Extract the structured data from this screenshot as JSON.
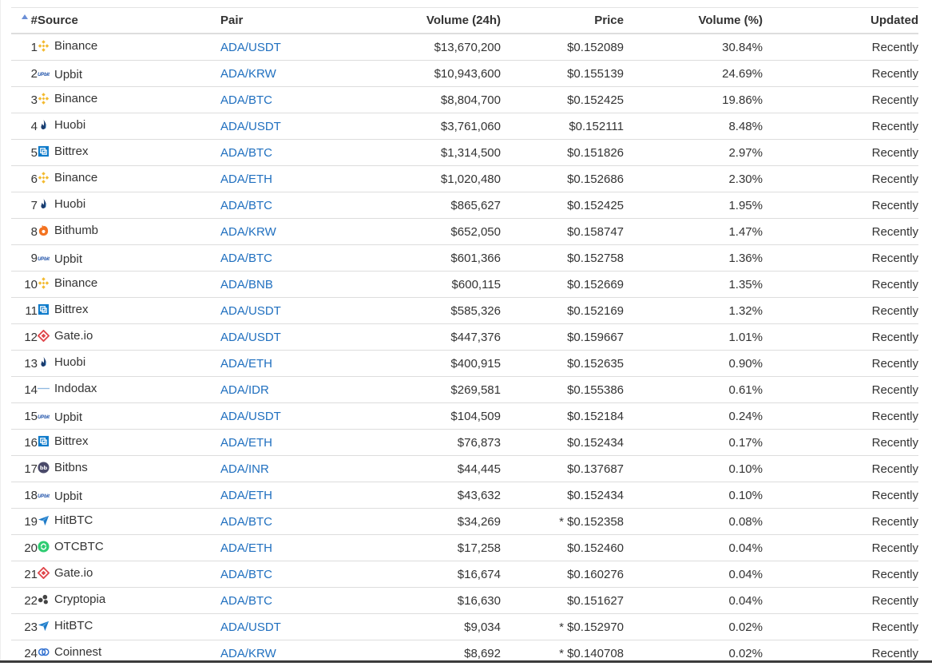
{
  "table": {
    "columns": {
      "rank": "#",
      "source": "Source",
      "pair": "Pair",
      "volume": "Volume (24h)",
      "price": "Price",
      "volume_pct": "Volume (%)",
      "updated": "Updated"
    },
    "sort_indicator": "sort-ascending-icon",
    "rows": [
      {
        "rank": "1",
        "source": "Binance",
        "icon": "binance-icon",
        "pair": "ADA/USDT",
        "volume": "$13,670,200",
        "price": "$0.152089",
        "estimated": "",
        "pct": "30.84%",
        "updated": "Recently"
      },
      {
        "rank": "2",
        "source": "Upbit",
        "icon": "upbit-icon",
        "pair": "ADA/KRW",
        "volume": "$10,943,600",
        "price": "$0.155139",
        "estimated": "",
        "pct": "24.69%",
        "updated": "Recently"
      },
      {
        "rank": "3",
        "source": "Binance",
        "icon": "binance-icon",
        "pair": "ADA/BTC",
        "volume": "$8,804,700",
        "price": "$0.152425",
        "estimated": "",
        "pct": "19.86%",
        "updated": "Recently"
      },
      {
        "rank": "4",
        "source": "Huobi",
        "icon": "huobi-icon",
        "pair": "ADA/USDT",
        "volume": "$3,761,060",
        "price": "$0.152111",
        "estimated": "",
        "pct": "8.48%",
        "updated": "Recently"
      },
      {
        "rank": "5",
        "source": "Bittrex",
        "icon": "bittrex-icon",
        "pair": "ADA/BTC",
        "volume": "$1,314,500",
        "price": "$0.151826",
        "estimated": "",
        "pct": "2.97%",
        "updated": "Recently"
      },
      {
        "rank": "6",
        "source": "Binance",
        "icon": "binance-icon",
        "pair": "ADA/ETH",
        "volume": "$1,020,480",
        "price": "$0.152686",
        "estimated": "",
        "pct": "2.30%",
        "updated": "Recently"
      },
      {
        "rank": "7",
        "source": "Huobi",
        "icon": "huobi-icon",
        "pair": "ADA/BTC",
        "volume": "$865,627",
        "price": "$0.152425",
        "estimated": "",
        "pct": "1.95%",
        "updated": "Recently"
      },
      {
        "rank": "8",
        "source": "Bithumb",
        "icon": "bithumb-icon",
        "pair": "ADA/KRW",
        "volume": "$652,050",
        "price": "$0.158747",
        "estimated": "",
        "pct": "1.47%",
        "updated": "Recently"
      },
      {
        "rank": "9",
        "source": "Upbit",
        "icon": "upbit-icon",
        "pair": "ADA/BTC",
        "volume": "$601,366",
        "price": "$0.152758",
        "estimated": "",
        "pct": "1.36%",
        "updated": "Recently"
      },
      {
        "rank": "10",
        "source": "Binance",
        "icon": "binance-icon",
        "pair": "ADA/BNB",
        "volume": "$600,115",
        "price": "$0.152669",
        "estimated": "",
        "pct": "1.35%",
        "updated": "Recently"
      },
      {
        "rank": "11",
        "source": "Bittrex",
        "icon": "bittrex-icon",
        "pair": "ADA/USDT",
        "volume": "$585,326",
        "price": "$0.152169",
        "estimated": "",
        "pct": "1.32%",
        "updated": "Recently"
      },
      {
        "rank": "12",
        "source": "Gate.io",
        "icon": "gateio-icon",
        "pair": "ADA/USDT",
        "volume": "$447,376",
        "price": "$0.159667",
        "estimated": "",
        "pct": "1.01%",
        "updated": "Recently"
      },
      {
        "rank": "13",
        "source": "Huobi",
        "icon": "huobi-icon",
        "pair": "ADA/ETH",
        "volume": "$400,915",
        "price": "$0.152635",
        "estimated": "",
        "pct": "0.90%",
        "updated": "Recently"
      },
      {
        "rank": "14",
        "source": "Indodax",
        "icon": "indodax-icon",
        "pair": "ADA/IDR",
        "volume": "$269,581",
        "price": "$0.155386",
        "estimated": "",
        "pct": "0.61%",
        "updated": "Recently"
      },
      {
        "rank": "15",
        "source": "Upbit",
        "icon": "upbit-icon",
        "pair": "ADA/USDT",
        "volume": "$104,509",
        "price": "$0.152184",
        "estimated": "",
        "pct": "0.24%",
        "updated": "Recently"
      },
      {
        "rank": "16",
        "source": "Bittrex",
        "icon": "bittrex-icon",
        "pair": "ADA/ETH",
        "volume": "$76,873",
        "price": "$0.152434",
        "estimated": "",
        "pct": "0.17%",
        "updated": "Recently"
      },
      {
        "rank": "17",
        "source": "Bitbns",
        "icon": "bitbns-icon",
        "pair": "ADA/INR",
        "volume": "$44,445",
        "price": "$0.137687",
        "estimated": "",
        "pct": "0.10%",
        "updated": "Recently"
      },
      {
        "rank": "18",
        "source": "Upbit",
        "icon": "upbit-icon",
        "pair": "ADA/ETH",
        "volume": "$43,632",
        "price": "$0.152434",
        "estimated": "",
        "pct": "0.10%",
        "updated": "Recently"
      },
      {
        "rank": "19",
        "source": "HitBTC",
        "icon": "hitbtc-icon",
        "pair": "ADA/BTC",
        "volume": "$34,269",
        "price": "$0.152358",
        "estimated": "*",
        "pct": "0.08%",
        "updated": "Recently"
      },
      {
        "rank": "20",
        "source": "OTCBTC",
        "icon": "otcbtc-icon",
        "pair": "ADA/ETH",
        "volume": "$17,258",
        "price": "$0.152460",
        "estimated": "",
        "pct": "0.04%",
        "updated": "Recently"
      },
      {
        "rank": "21",
        "source": "Gate.io",
        "icon": "gateio-icon",
        "pair": "ADA/BTC",
        "volume": "$16,674",
        "price": "$0.160276",
        "estimated": "",
        "pct": "0.04%",
        "updated": "Recently"
      },
      {
        "rank": "22",
        "source": "Cryptopia",
        "icon": "cryptopia-icon",
        "pair": "ADA/BTC",
        "volume": "$16,630",
        "price": "$0.151627",
        "estimated": "",
        "pct": "0.04%",
        "updated": "Recently"
      },
      {
        "rank": "23",
        "source": "HitBTC",
        "icon": "hitbtc-icon",
        "pair": "ADA/USDT",
        "volume": "$9,034",
        "price": "$0.152970",
        "estimated": "*",
        "pct": "0.02%",
        "updated": "Recently"
      },
      {
        "rank": "24",
        "source": "Coinnest",
        "icon": "coinnest-icon",
        "pair": "ADA/KRW",
        "volume": "$8,692",
        "price": "$0.140708",
        "estimated": "*",
        "pct": "0.02%",
        "updated": "Recently"
      }
    ]
  },
  "icon_logo_text": {
    "upbit": "UPbit",
    "bitbns": "bb"
  },
  "colors": {
    "link": "#1f6fbf",
    "binance": "#f3ba2f",
    "upbit": "#1b4fa8",
    "huobi": "#1a3c6e",
    "bittrex": "#0f7ccb",
    "bithumb": "#f37321",
    "gateio": "#e0474c",
    "indodax": "#8fb8e0",
    "bitbns": "#4a4a6a",
    "hitbtc": "#1f7bc7",
    "otcbtc": "#2ecc71",
    "cryptopia": "#444444",
    "coinnest": "#2f6fd0",
    "sort_arrow": "#6b8fd6"
  }
}
